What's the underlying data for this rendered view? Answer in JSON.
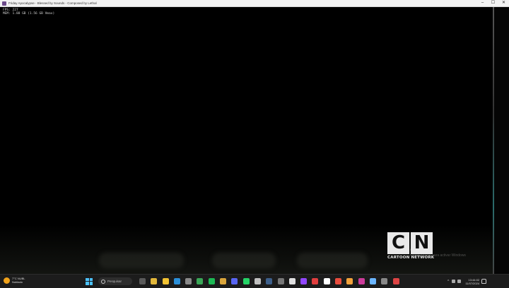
{
  "window": {
    "title": "Friday Apocalypse - Blessed by Sounds - Composed by Lethal",
    "controls": [
      "–",
      "☐",
      "✕"
    ]
  },
  "game": {
    "debug_lines": [
      "FPS: 227",
      "MEM: 1.88 GB (1.56 GB Vmax)"
    ]
  },
  "overlay": {
    "watermark_line1": "Windows",
    "watermark_line2": "configuracion para activar Windows",
    "logo_letters": [
      "C",
      "N"
    ],
    "logo_text": "CARTOON NETWORK"
  },
  "taskbar": {
    "weather_temp": "7°C NUBL",
    "weather_desc": "Nublado",
    "search_placeholder": "Pesquisar",
    "pinned_icons": [
      {
        "name": "task-view-icon",
        "color": "#5a5a5a"
      },
      {
        "name": "widget-icon",
        "color": "#e2b73a"
      },
      {
        "name": "file-explorer-icon",
        "color": "#f1c232"
      },
      {
        "name": "edge-icon",
        "color": "#2b8fd8"
      },
      {
        "name": "settings-icon",
        "color": "#8a8a8a"
      },
      {
        "name": "chrome-icon",
        "color": "#3aa757"
      },
      {
        "name": "spotify-icon",
        "color": "#1db954"
      },
      {
        "name": "folder-icon",
        "color": "#d9a53b"
      },
      {
        "name": "discord-icon",
        "color": "#5865f2"
      },
      {
        "name": "whatsapp-icon",
        "color": "#25d366"
      },
      {
        "name": "app-icon-11",
        "color": "#c0c0c0"
      },
      {
        "name": "steam-icon",
        "color": "#3d5f8a"
      },
      {
        "name": "app-icon-13",
        "color": "#777777"
      },
      {
        "name": "app-icon-14",
        "color": "#e0e0e0"
      },
      {
        "name": "twitch-icon",
        "color": "#9146ff"
      },
      {
        "name": "app-icon-16",
        "color": "#e03e3e"
      },
      {
        "name": "app-icon-17",
        "color": "#ffffff"
      },
      {
        "name": "app-icon-18",
        "color": "#e84c3d"
      },
      {
        "name": "app-icon-19",
        "color": "#f3a33b"
      },
      {
        "name": "app-icon-20",
        "color": "#cc3b9a"
      },
      {
        "name": "app-icon-21",
        "color": "#6bb5ff"
      },
      {
        "name": "app-icon-22",
        "color": "#888888"
      },
      {
        "name": "app-icon-23",
        "color": "#d44"
      }
    ],
    "tray_chevron": "^",
    "clock_time": "13:44:02",
    "clock_date": "11/07/2024"
  }
}
